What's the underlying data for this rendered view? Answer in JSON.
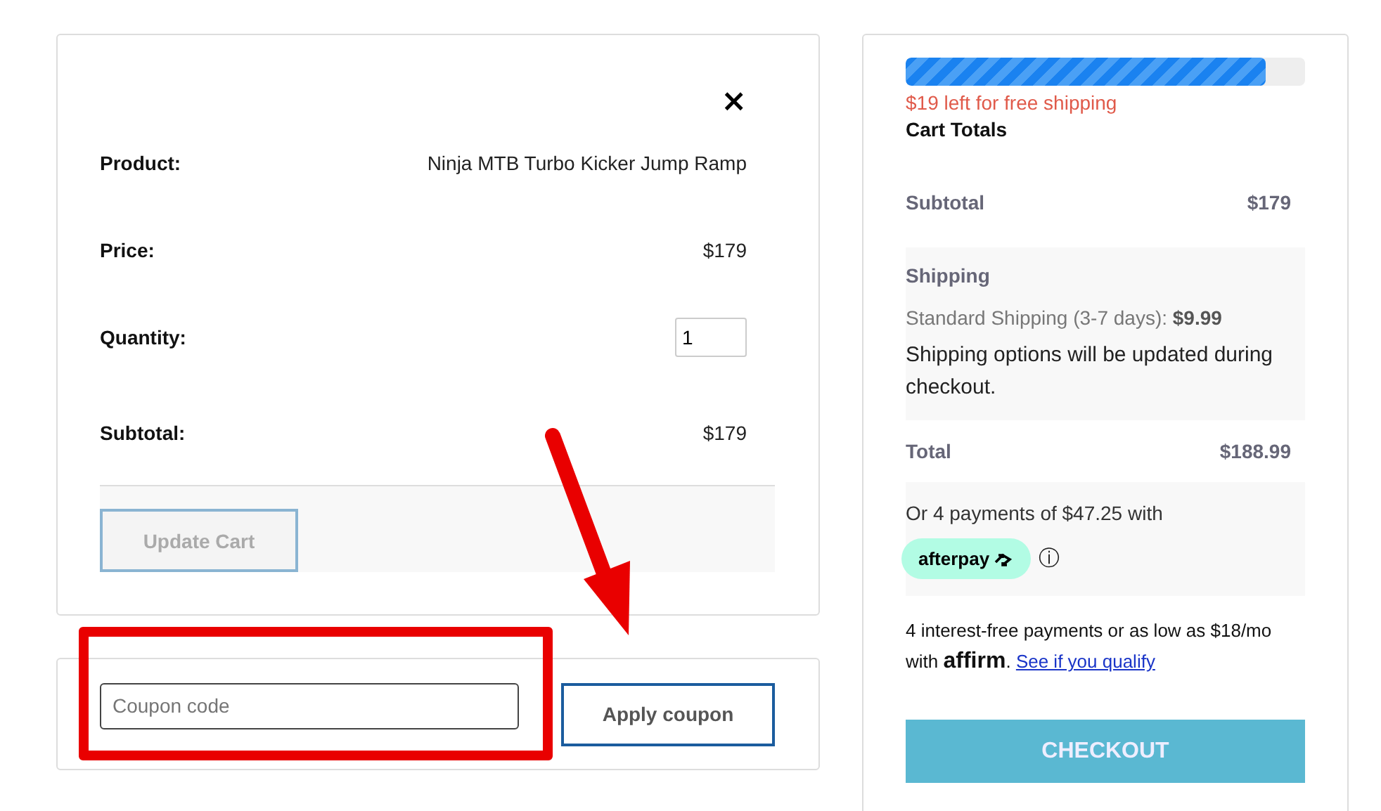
{
  "cart_item": {
    "close": "×",
    "rows": [
      {
        "label": "Product:",
        "kind": "text",
        "value": "Ninja MTB Turbo Kicker Jump Ramp"
      },
      {
        "label": "Price:",
        "kind": "text",
        "value": "$179"
      },
      {
        "label": "Quantity:",
        "kind": "input",
        "value": "1"
      },
      {
        "label": "Subtotal:",
        "kind": "text",
        "value": "$179"
      }
    ],
    "update_button": {
      "label": "Update Cart",
      "disabled": true
    }
  },
  "coupon": {
    "placeholder": "Coupon code",
    "button": "Apply coupon"
  },
  "cart_totals": {
    "free_shipping": {
      "level": 0.9,
      "message": "$19 left for free shipping"
    },
    "title": "Cart Totals",
    "subtotal": {
      "label": "Subtotal",
      "value": "$179"
    },
    "shipping": {
      "label": "Shipping",
      "method": "Standard Shipping (3-7 days): **$9.99**",
      "note": "Shipping options will be updated during checkout."
    },
    "total": {
      "label": "Total",
      "value": "$188.99"
    },
    "afterpay": {
      "message": "Or 4 payments of $47.25 with",
      "badge": "afterpay",
      "info": "ⓘ"
    },
    "affirm": {
      "message": "4 interest-free payments or as low as $18/mo with **affirm**.",
      "link": "See if you qualify"
    },
    "checkout": "CHECKOUT"
  }
}
